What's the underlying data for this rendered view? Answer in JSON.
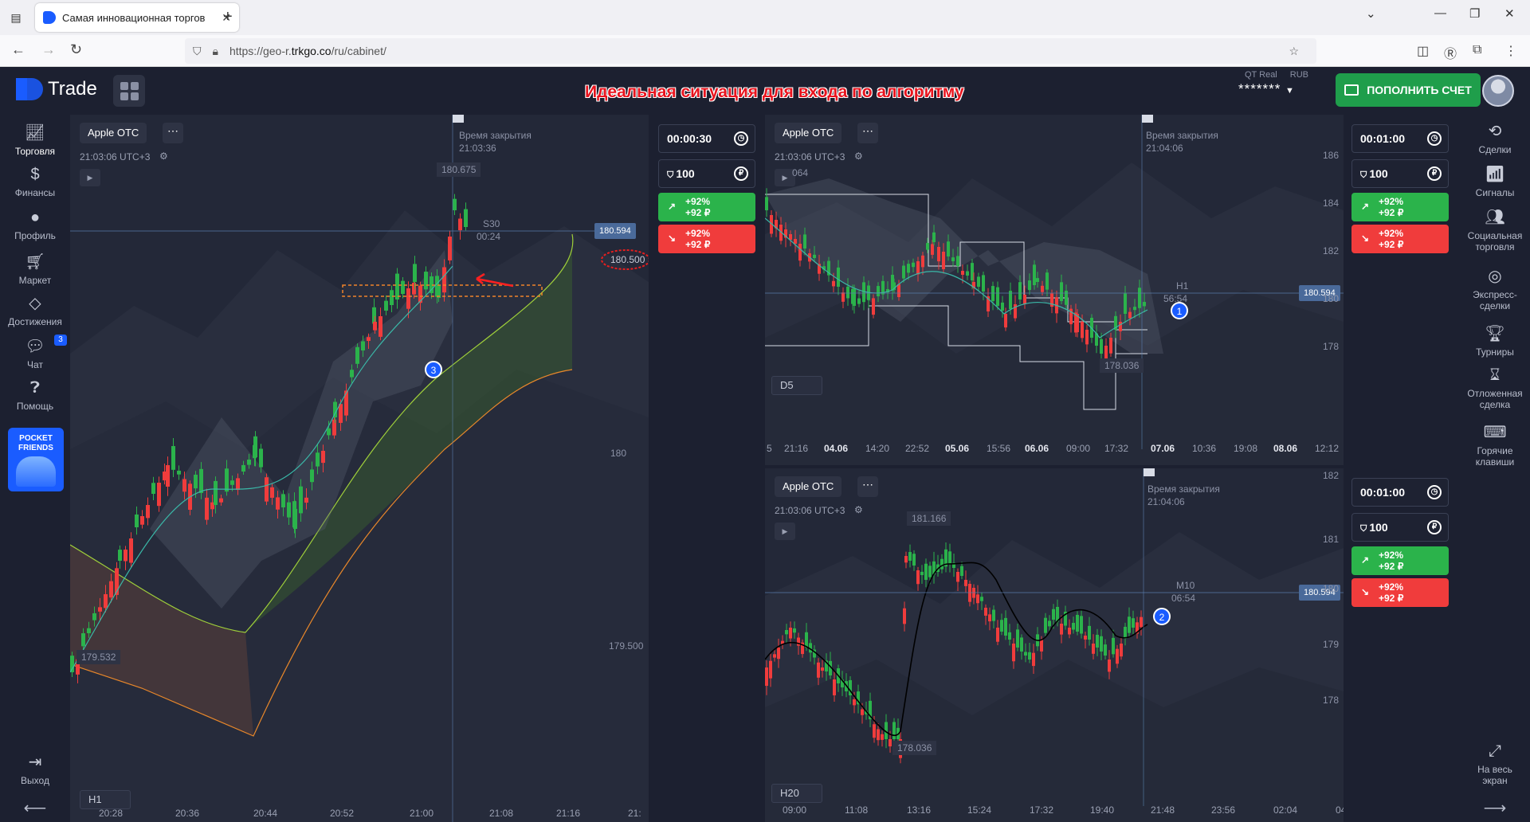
{
  "browser": {
    "tab_title": "Самая инновационная торгов",
    "url_prefix": "https://geo-r.",
    "url_domain": "trkgo.co",
    "url_path": "/ru/cabinet/"
  },
  "header": {
    "logo_text": "Trade",
    "headline": "Идеальная ситуация для входа по алгоритму",
    "account_type": "QT Real",
    "currency": "RUB",
    "balance_masked": "*******",
    "topup_label": "ПОПОЛНИТЬ СЧЕТ"
  },
  "left_sidebar": {
    "items": [
      {
        "label": "Торговля",
        "icon": "chart-line-icon"
      },
      {
        "label": "Финансы",
        "icon": "dollar-icon"
      },
      {
        "label": "Профиль",
        "icon": "user-icon"
      },
      {
        "label": "Маркет",
        "icon": "cart-icon"
      },
      {
        "label": "Достижения",
        "icon": "diamond-icon"
      },
      {
        "label": "Чат",
        "icon": "chat-icon"
      },
      {
        "label": "Помощь",
        "icon": "help-icon"
      }
    ],
    "chat_badge": "3",
    "promo": "POCKET FRIENDS",
    "logout_label": "Выход"
  },
  "right_sidebar": {
    "items": [
      {
        "label": "Сделки"
      },
      {
        "label": "Сигналы"
      },
      {
        "label": "Социальная торговля"
      },
      {
        "label": "Экспресс-сделки"
      },
      {
        "label": "Турниры"
      },
      {
        "label": "Отложенная сделка"
      },
      {
        "label": "Горячие клавиши"
      }
    ],
    "fullscreen_label": "На весь экран"
  },
  "charts": [
    {
      "asset": "Apple OTC",
      "time": "21:03:06 UTC+3",
      "timeframe": "H1",
      "close_title": "Время закрытия",
      "close_time": "21:03:36",
      "period": "S30",
      "countdown": "00:24",
      "high": "180.675",
      "low": "179.532",
      "current_price": "180.594",
      "marked_price": "180.500",
      "price_axis": [
        "180",
        "179.500"
      ],
      "x_axis": [
        "20:28",
        "20:36",
        "20:44",
        "20:52",
        "21:00",
        "21:08",
        "21:16",
        "21:"
      ],
      "marker": "3"
    },
    {
      "asset": "Apple OTC",
      "time": "21:03:06 UTC+3",
      "timeframe": "D5",
      "close_title": "Время закрытия",
      "close_time": "21:04:06",
      "period": "H1",
      "countdown": "56:54",
      "high": "064",
      "low": "178.036",
      "current_price": "180.594",
      "price_axis": [
        "186",
        "184",
        "182",
        "180",
        "178"
      ],
      "x_axis": [
        {
          "t": "5",
          "b": false
        },
        {
          "t": "21:16",
          "b": false
        },
        {
          "t": "04.06",
          "b": true
        },
        {
          "t": "14:20",
          "b": false
        },
        {
          "t": "22:52",
          "b": false
        },
        {
          "t": "05.06",
          "b": true
        },
        {
          "t": "15:56",
          "b": false
        },
        {
          "t": "06.06",
          "b": true
        },
        {
          "t": "09:00",
          "b": false
        },
        {
          "t": "17:32",
          "b": false
        },
        {
          "t": "07.06",
          "b": true
        },
        {
          "t": "10:36",
          "b": false
        },
        {
          "t": "19:08",
          "b": false
        },
        {
          "t": "08.06",
          "b": true
        },
        {
          "t": "12:12",
          "b": false
        }
      ],
      "marker": "1"
    },
    {
      "asset": "Apple OTC",
      "time": "21:03:06 UTC+3",
      "timeframe": "H20",
      "close_title": "Время закрытия",
      "close_time": "21:04:06",
      "period": "M10",
      "countdown": "06:54",
      "high": "181.166",
      "low": "178.036",
      "current_price": "180.594",
      "price_axis": [
        "182",
        "181",
        "180",
        "179",
        "178"
      ],
      "x_axis": [
        "09:00",
        "11:08",
        "13:16",
        "15:24",
        "17:32",
        "19:40",
        "21:48",
        "23:56",
        "02:04",
        "04"
      ],
      "marker": "2"
    }
  ],
  "trade_panels": [
    {
      "timer": "00:00:30",
      "amount": "100",
      "up": [
        "+92%",
        "+92 ₽"
      ],
      "down": [
        "+92%",
        "+92 ₽"
      ]
    },
    {
      "timer": "00:01:00",
      "amount": "100",
      "up": [
        "+92%",
        "+92 ₽"
      ],
      "down": [
        "+92%",
        "+92 ₽"
      ]
    },
    {
      "timer": "00:01:00",
      "amount": "100",
      "up": [
        "+92%",
        "+92 ₽"
      ],
      "down": [
        "+92%",
        "+92 ₽"
      ]
    }
  ],
  "colors": {
    "up": "#2bb34b",
    "down": "#f03c3c",
    "accent": "#1a5cff",
    "headline": "#e8141e"
  }
}
